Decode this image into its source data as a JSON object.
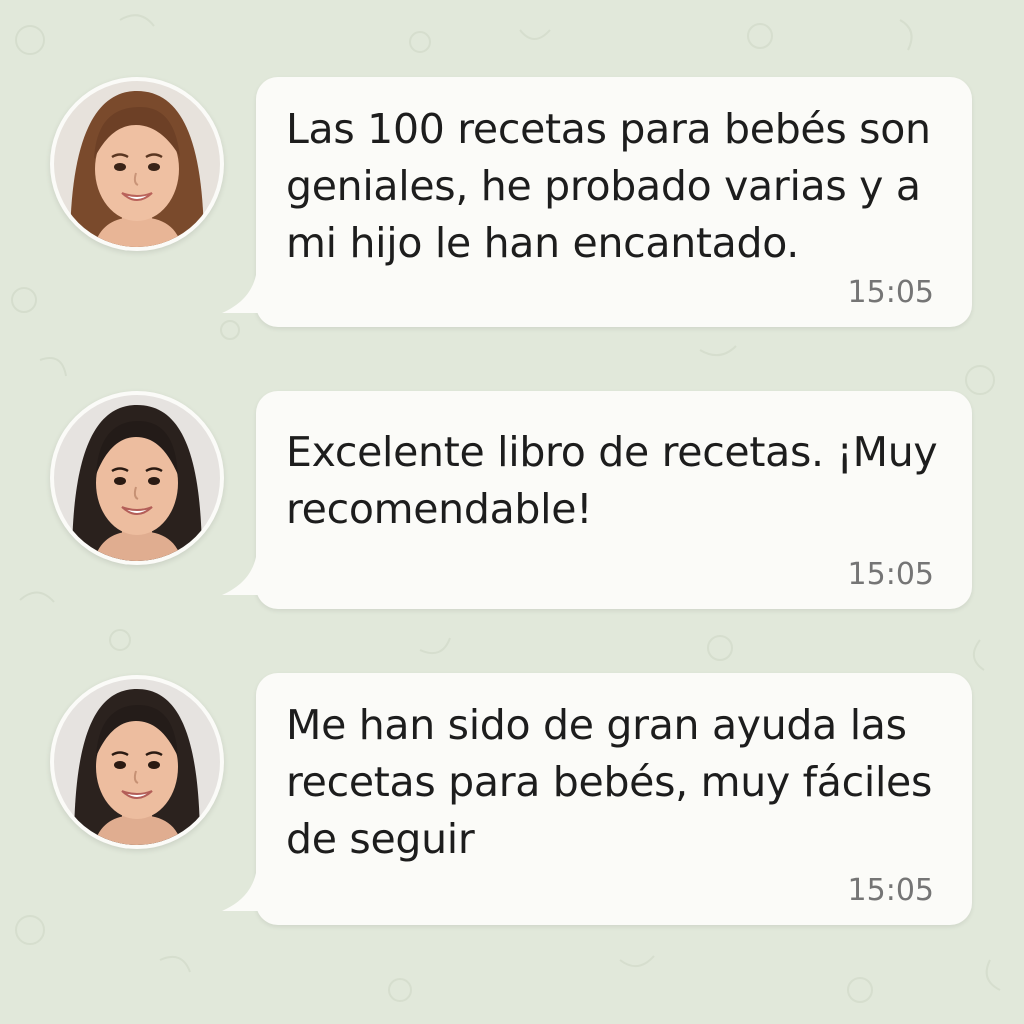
{
  "background_color": "#e1e8da",
  "bubble_color": "#fbfbf8",
  "messages": [
    {
      "text": "Las 100 recetas para bebés son geniales, he probado varias y a mi hijo le han encantado.",
      "time": "15:05",
      "avatar": "woman-brown-hair-avatar"
    },
    {
      "text": "Excelente libro de recetas. ¡Muy recomendable!",
      "time": "15:05",
      "avatar": "woman-dark-hair-avatar"
    },
    {
      "text": "Me han sido de gran ayuda las recetas para bebés, muy fáciles de seguir",
      "time": "15:05",
      "avatar": "woman-dark-hair-avatar"
    }
  ]
}
